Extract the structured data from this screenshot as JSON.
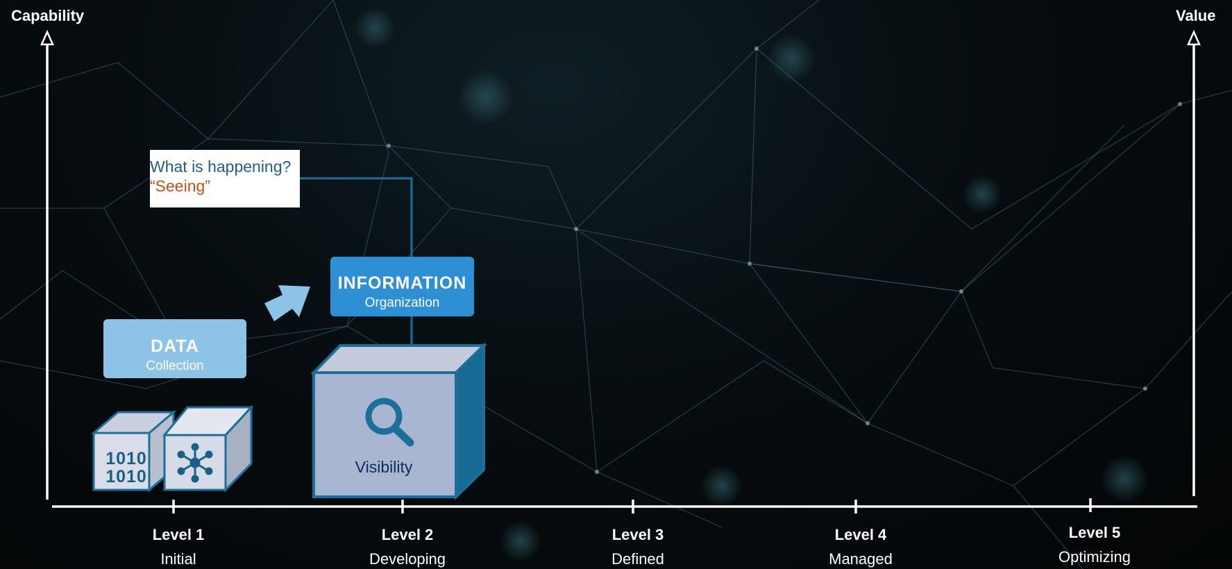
{
  "axes": {
    "left_title": "Capability",
    "right_title": "Value"
  },
  "levels": [
    {
      "name": "Level 1",
      "stage": "Initial"
    },
    {
      "name": "Level 2",
      "stage": "Developing"
    },
    {
      "name": "Level 3",
      "stage": "Defined"
    },
    {
      "name": "Level 4",
      "stage": "Managed"
    },
    {
      "name": "Level 5",
      "stage": "Optimizing"
    }
  ],
  "data_box": {
    "title": "DATA",
    "subtitle": "Collection"
  },
  "information_box": {
    "title": "INFORMATION",
    "subtitle": "Organization"
  },
  "callout": {
    "question": "What is happening?",
    "answer": "“Seeing”"
  },
  "cube": {
    "label": "Visibility"
  },
  "binary_cube_text": "1010",
  "icons": [
    "binary-data-icon",
    "network-hub-icon",
    "magnifier-icon",
    "right-arrow-icon"
  ],
  "colors": {
    "data_box": "#8ec3e8",
    "information_box": "#2e8fd4",
    "cube_face": "#a8b6d2",
    "cube_side": "#176a96",
    "callout_question": "#1f5f88",
    "callout_answer": "#c65014"
  }
}
